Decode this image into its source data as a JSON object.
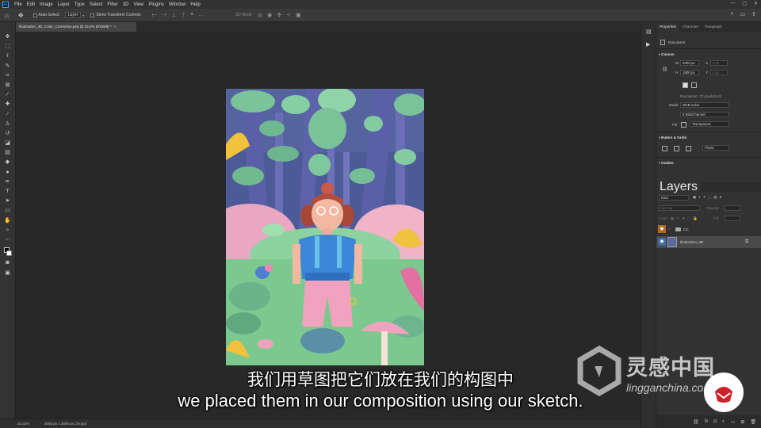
{
  "menubar": {
    "logo": "Ps",
    "items": [
      "File",
      "Edit",
      "Image",
      "Layer",
      "Type",
      "Select",
      "Filter",
      "3D",
      "View",
      "Plugins",
      "Window",
      "Help"
    ],
    "window_controls": [
      "—",
      "▢",
      "✕"
    ]
  },
  "options": {
    "auto_select_label": "Auto-Select:",
    "auto_select_value": "Layer",
    "transform_label": "Show Transform Controls",
    "mode_label": "3D Mode:"
  },
  "document": {
    "tab_title": "Illustration_3D_Color_Correction.psd @ 33,3% (RGB/8) *",
    "tab_close": "×",
    "zoom": "33,33%",
    "doc_size": "2000 px x 2800 px (72 ppi)"
  },
  "properties": {
    "tabs": [
      "Properties",
      "Character",
      "Paragraph"
    ],
    "type": "Document",
    "canvas": {
      "title": "Canvas",
      "w_label": "W",
      "w_value": "2000 px",
      "h_label": "H",
      "h_value": "2800 px",
      "x_label": "X",
      "y_label": "Y",
      "x_value": "0 px",
      "y_value": "0 px",
      "resolution": "Resolution: 72 pixels/inch",
      "mode_label": "Mode",
      "mode_value": "RGB Color",
      "depth_value": "8 Bits/Channel",
      "fill_label": "Fill",
      "fill_value": "Transparent"
    },
    "rulers": {
      "title": "Rulers & Grids",
      "unit": "Pixels"
    },
    "guides": {
      "title": "Guides"
    }
  },
  "layers": {
    "tab": "Layers",
    "kind_label": "Kind",
    "blend_mode": "Normal",
    "opacity_label": "Opacity:",
    "lock_label": "Lock:",
    "fill_label": "Fill:",
    "items": [
      {
        "name": "CC",
        "type": "group",
        "eye_color": "#b0681c"
      },
      {
        "name": "Illustration_3D",
        "type": "layer",
        "eye_color": "#3d6fa5"
      }
    ]
  },
  "subtitles": {
    "chinese": "我们用草图把它们放在我们的构图中",
    "english": "we placed them in our composition using our sketch."
  },
  "watermark": {
    "title": "灵感中国",
    "url": "lingganchina.com"
  }
}
